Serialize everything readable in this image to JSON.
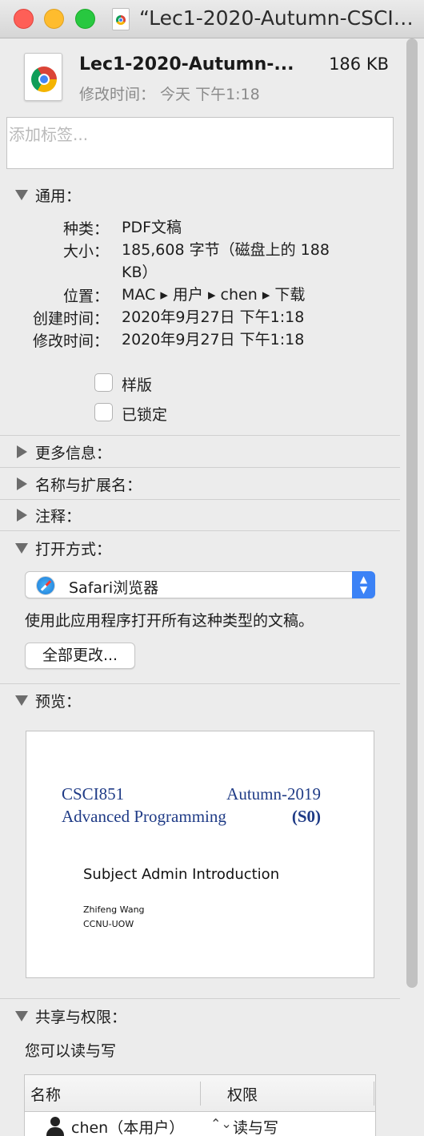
{
  "window": {
    "title": "“Lec1-2020-Autumn-CSCI…"
  },
  "file": {
    "name": "Lec1-2020-Autumn-...",
    "size": "186 KB",
    "modified": "修改时间：  今天 下午1:18"
  },
  "tags": {
    "placeholder": "添加标签..."
  },
  "general": {
    "heading": "通用：",
    "kind_label": "种类：",
    "kind": "PDF文稿",
    "size_label": "大小：",
    "size": "185,608 字节（磁盘上的 188 KB）",
    "where_label": "位置：",
    "where": "MAC ▸ 用户 ▸ chen ▸ 下载",
    "created_label": "创建时间：",
    "created": "2020年9月27日 下午1:18",
    "modified_label": "修改时间：",
    "modified": "2020年9月27日 下午1:18",
    "stationery_label": "样版",
    "locked_label": "已锁定"
  },
  "sections": {
    "more_info": "更多信息：",
    "name_ext": "名称与扩展名：",
    "comments": "注释：",
    "open_with": "打开方式：",
    "preview": "预览：",
    "sharing": "共享与权限："
  },
  "open_with": {
    "app": "Safari浏览器",
    "note": "使用此应用程序打开所有这种类型的文稿。",
    "change_all": "全部更改..."
  },
  "preview": {
    "course": "CSCI851",
    "term": "Autumn-2019",
    "course_name": "Advanced Programming",
    "section": "(S0)",
    "subject": "Subject Admin Introduction",
    "author": "Zhifeng Wang",
    "org": "CCNU-UOW"
  },
  "sharing": {
    "note": "您可以读与写",
    "col_name": "名称",
    "col_priv": "权限",
    "rows": [
      {
        "name": "chen（本用户）",
        "privilege": "读与写"
      }
    ]
  },
  "icons": {
    "file": "chrome-pdf-icon",
    "app": "safari-icon",
    "user": "user-icon"
  },
  "colors": {
    "accent": "#3b82f6",
    "close": "#fe5f57",
    "minimize": "#febc2e",
    "zoom": "#28c840",
    "preview_text": "#1f3b86"
  }
}
